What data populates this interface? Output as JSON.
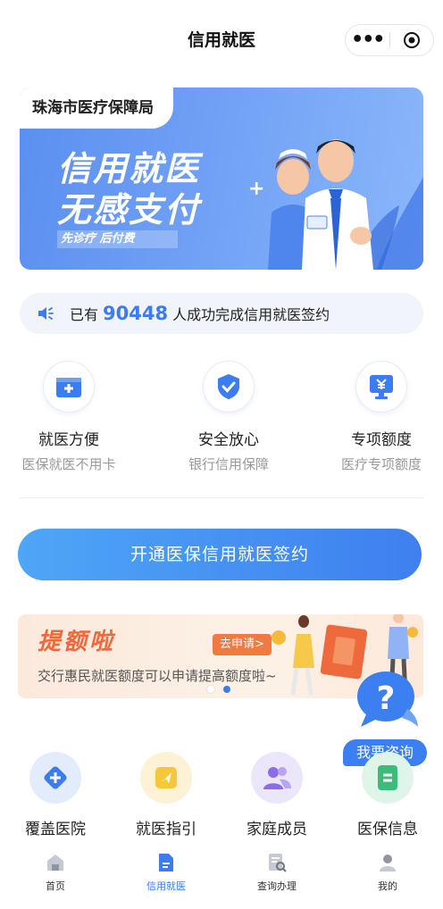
{
  "header": {
    "title": "信用就医"
  },
  "banner": {
    "tag": "珠海市医疗保障局",
    "line1": "信用就医",
    "line2": "无感支付",
    "sub": "先诊疗 后付费"
  },
  "stat": {
    "prefix": "已有",
    "count": "90448",
    "suffix": "人成功完成信用就医签约"
  },
  "features": [
    {
      "title": "就医方便",
      "sub": "医保就医不用卡",
      "icon": "medical-card-icon"
    },
    {
      "title": "安全放心",
      "sub": "银行信用保障",
      "icon": "shield-check-icon"
    },
    {
      "title": "专项额度",
      "sub": "医疗专项额度",
      "icon": "yuan-monitor-icon"
    }
  ],
  "cta": {
    "label": "开通医保信用就医签约"
  },
  "promo": {
    "title": "提额啦",
    "button": "去申请>",
    "desc": "交行惠民就医额度可以申请提高额度啦~"
  },
  "consult": {
    "label": "我要咨询"
  },
  "services": [
    {
      "label": "覆盖医院",
      "icon": "hospital-plus-icon"
    },
    {
      "label": "就医指引",
      "icon": "guide-arrow-icon"
    },
    {
      "label": "家庭成员",
      "icon": "family-members-icon"
    },
    {
      "label": "医保信息",
      "icon": "insurance-info-icon"
    }
  ],
  "tabs": [
    {
      "label": "首页",
      "icon": "home-icon"
    },
    {
      "label": "信用就医",
      "icon": "credit-doc-icon",
      "active": true
    },
    {
      "label": "查询办理",
      "icon": "query-icon"
    },
    {
      "label": "我的",
      "icon": "profile-icon"
    }
  ],
  "colors": {
    "primary": "#3b7cf0",
    "promo_orange": "#f2683a"
  }
}
